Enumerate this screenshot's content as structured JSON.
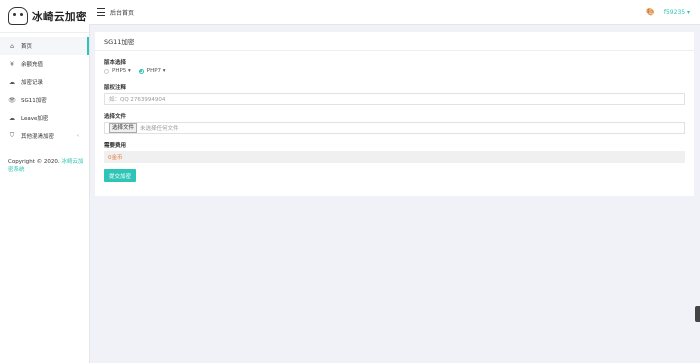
{
  "brand": {
    "name": "冰崎云加密"
  },
  "topbar": {
    "title": "后台首页",
    "user": "f59235 ▾"
  },
  "sidebar": {
    "items": [
      {
        "icon": "⌂",
        "label": "首页",
        "active": true
      },
      {
        "icon": "¥",
        "label": "余额充值"
      },
      {
        "icon": "☁",
        "label": "加密记录"
      },
      {
        "icon": "👁",
        "label": "SG11加密"
      },
      {
        "icon": "☁",
        "label": "Leave加密"
      },
      {
        "icon": "⛉",
        "label": "其他混淆加密",
        "caret": "‹"
      }
    ],
    "copyright_text": "Copyright © 2020.",
    "copyright_link": "冰崎云加密系统"
  },
  "panel": {
    "title": "SG11加密",
    "version_label": "版本选择",
    "version_options": [
      {
        "label": "PHP5 ▾",
        "checked": false
      },
      {
        "label": "PHP7 ▾",
        "checked": true
      }
    ],
    "license_label": "版权注释",
    "license_placeholder": "如：QQ 2763994904",
    "file_label": "选择文件",
    "file_button": "选择文件",
    "file_status": "未选择任何文件",
    "cost_label": "需要费用",
    "cost_value": "0金币",
    "submit_label": "提交加密"
  },
  "colors": {
    "accent": "#2ec4b6",
    "background": "#f1f2f7"
  }
}
